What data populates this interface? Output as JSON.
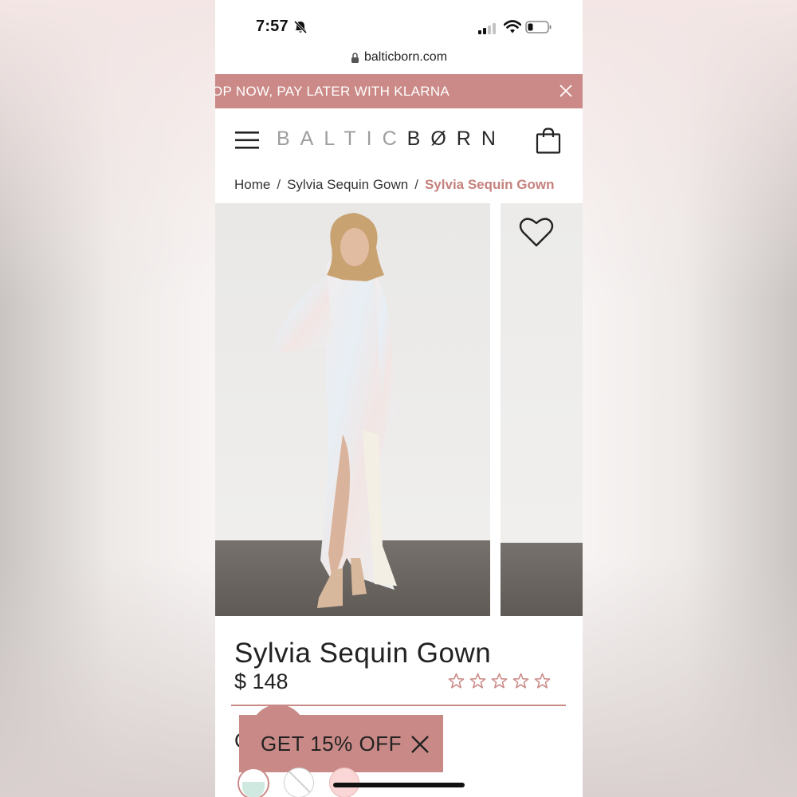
{
  "status_bar": {
    "time": "7:57"
  },
  "browser": {
    "url": "balticborn.com"
  },
  "promo": {
    "text": "OP NOW, PAY LATER WITH KLARNA"
  },
  "header": {
    "logo_part1": "BALTIC",
    "logo_part2": "BØRN"
  },
  "breadcrumb": {
    "items": [
      "Home",
      "Sylvia Sequin Gown",
      "Sylvia Sequin Gown"
    ],
    "separator": "/"
  },
  "product": {
    "title": "Sylvia Sequin Gown",
    "price": "$ 148",
    "rating_stars": 5,
    "rating_value": 0
  },
  "bottom": {
    "partial_label": "C",
    "discount_label": "GET 15% OFF"
  },
  "colors": {
    "accent": "#cb8a87",
    "breadcrumb_active": "#c5817d",
    "logo_light": "#9d9d9d",
    "logo_dark": "#2a2a2a",
    "swatch_mint": "#cfe9e0",
    "swatch_pink": "#fbd6d7"
  },
  "icons": [
    "bell-slash-icon",
    "signal-icon",
    "wifi-icon",
    "battery-icon",
    "lock-icon",
    "close-icon",
    "hamburger-menu-icon",
    "shopping-bag-icon",
    "heart-icon",
    "star-icon"
  ]
}
